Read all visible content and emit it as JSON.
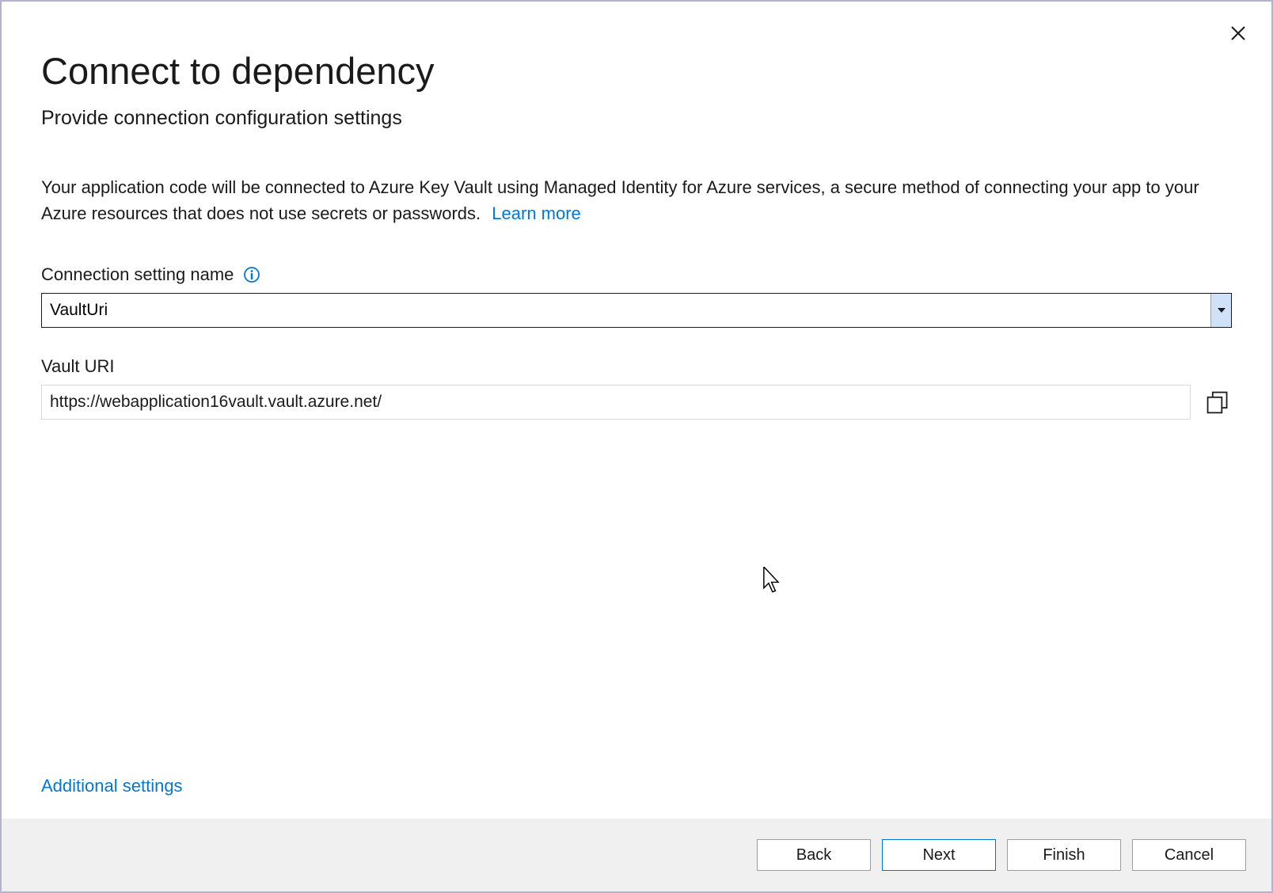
{
  "dialog": {
    "title": "Connect to dependency",
    "subtitle": "Provide connection configuration settings",
    "description": "Your application code will be connected to Azure Key Vault using Managed Identity for Azure services, a secure method of connecting your app to your Azure resources that does not use secrets or passwords.",
    "learn_more": "Learn more"
  },
  "fields": {
    "connection_setting_label": "Connection setting name",
    "connection_setting_value": "VaultUri",
    "vault_uri_label": "Vault URI",
    "vault_uri_value": "https://webapplication16vault.vault.azure.net/"
  },
  "links": {
    "additional_settings": "Additional settings"
  },
  "buttons": {
    "back": "Back",
    "next": "Next",
    "finish": "Finish",
    "cancel": "Cancel"
  }
}
